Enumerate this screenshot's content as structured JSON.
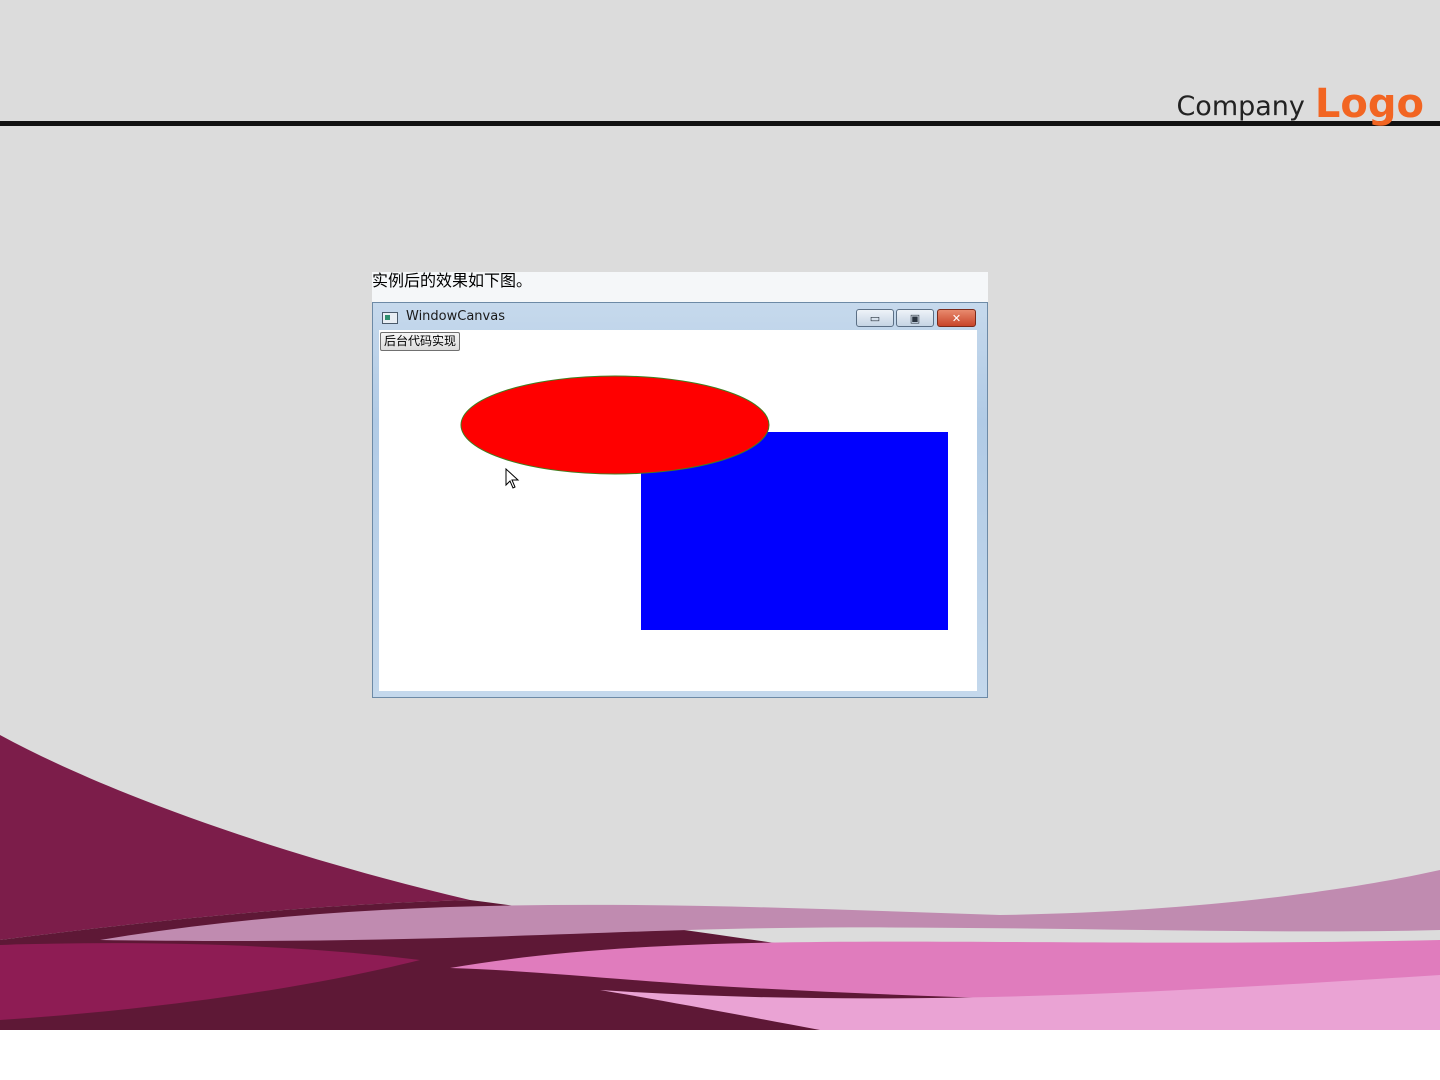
{
  "slide": {
    "company_text": "Company",
    "logo_text": "Logo",
    "caption": "实例后的效果如下图。"
  },
  "window": {
    "title": "WindowCanvas",
    "controls": {
      "minimize": "▭",
      "maximize": "▣",
      "close": "✕"
    },
    "button_label": "后台代码实现"
  },
  "colors": {
    "ellipse_fill": "#ff0000",
    "ellipse_stroke": "#3f7f1f",
    "rectangle_fill": "#0000ff",
    "logo": "#f26522",
    "wave_dark": "#7c1d4a",
    "wave_light": "#c08bb0",
    "wave_pink": "#e07cbd"
  },
  "icons": [
    "window-app-icon",
    "mouse-cursor-icon"
  ]
}
